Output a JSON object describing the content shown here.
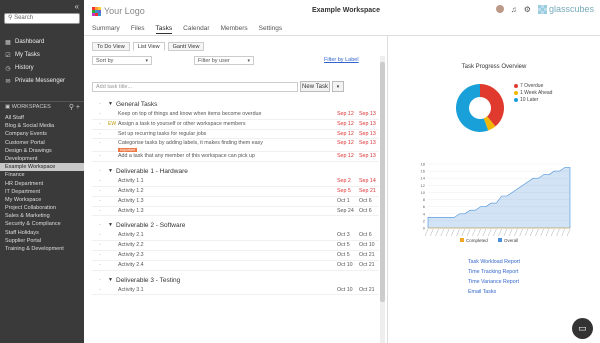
{
  "sidebar": {
    "search_placeholder": "Search",
    "nav": [
      {
        "label": "Dashboard",
        "icon": "dashboard-icon"
      },
      {
        "label": "My Tasks",
        "icon": "check-icon"
      },
      {
        "label": "History",
        "icon": "clock-icon"
      },
      {
        "label": "Private Messenger",
        "icon": "chat-icon"
      }
    ],
    "workspaces_label": "WORKSPACES",
    "workspaces": [
      "All Staff",
      "Blog & Social Media",
      "Company Events",
      "Customer Portal",
      "Design & Drawings",
      "Development",
      "Example Workspace",
      "Finance",
      "HR Department",
      "IT Department",
      "My Workspace",
      "Project Collaboration",
      "Sales & Marketing",
      "Security & Compliance",
      "Staff Holidays",
      "Supplier Portal",
      "Training & Development"
    ],
    "active_workspace": "Example Workspace"
  },
  "header": {
    "logo_text": "Your Logo",
    "workspace_title": "Example Workspace",
    "brand": "glasscubes",
    "tabs": [
      "Summary",
      "Files",
      "Tasks",
      "Calendar",
      "Members",
      "Settings"
    ],
    "active_tab": "Tasks"
  },
  "tasks_view": {
    "views": [
      "To Do View",
      "List View",
      "Gantt View"
    ],
    "sort_label": "Sort by",
    "filter_user_label": "Filter by user",
    "filter_label_link": "Filter by Label",
    "new_task_placeholder": "Add task title...",
    "new_task_button": "New Task",
    "groups": [
      {
        "name": "General Tasks",
        "tasks": [
          {
            "title": "Keep on top of things and know when items become overdue",
            "d1": "Sep 12",
            "d2": "Sep 13",
            "flag": ""
          },
          {
            "title": "Assign a task to yourself or other workspace members",
            "d1": "Sep 12",
            "d2": "Sep 13",
            "flag": "EW"
          },
          {
            "title": "Set up recurring tasks for regular jobs",
            "d1": "Sep 12",
            "d2": "Sep 13",
            "flag": ""
          },
          {
            "title": "Categorise tasks by adding labels, it makes finding them easy",
            "d1": "Sep 12",
            "d2": "Sep 13",
            "flag": "",
            "tag": "Important"
          },
          {
            "title": "Add a task that any member of this workspace can pick up",
            "d1": "Sep 12",
            "d2": "Sep 13",
            "flag": ""
          }
        ]
      },
      {
        "name": "Deliverable 1 - Hardware",
        "tasks": [
          {
            "title": "Activity 1.1",
            "d1": "Sep 2",
            "d2": "Sep 14",
            "flag": "",
            "ok": false
          },
          {
            "title": "Activity 1.2",
            "d1": "Sep 5",
            "d2": "Sep 21",
            "flag": "",
            "ok": false
          },
          {
            "title": "Activity 1.3",
            "d1": "Oct 1",
            "d2": "Oct 6",
            "flag": "",
            "ok": true
          },
          {
            "title": "Activity 1.3",
            "d1": "Sep 24",
            "d2": "Oct 6",
            "flag": "",
            "ok": true
          }
        ]
      },
      {
        "name": "Deliverable 2 - Software",
        "tasks": [
          {
            "title": "Activity 2.1",
            "d1": "Oct 3",
            "d2": "Oct 6",
            "flag": "",
            "ok": true
          },
          {
            "title": "Activity 2.2",
            "d1": "Oct 5",
            "d2": "Oct 10",
            "flag": "",
            "ok": true
          },
          {
            "title": "Activity 2.3",
            "d1": "Oct 5",
            "d2": "Oct 21",
            "flag": "",
            "ok": true
          },
          {
            "title": "Activity 2.4",
            "d1": "Oct 10",
            "d2": "Oct 21",
            "flag": "",
            "ok": true
          }
        ]
      },
      {
        "name": "Deliverable 3 - Testing",
        "tasks": [
          {
            "title": "Activity 3.1",
            "d1": "Oct 10",
            "d2": "Oct 21",
            "flag": "",
            "ok": true
          }
        ]
      }
    ]
  },
  "overview": {
    "title": "Task Progress Overview",
    "legend": [
      {
        "label": "7 Overdue",
        "color": "#e03a2f"
      },
      {
        "label": "1 Week Ahead",
        "color": "#f2b705"
      },
      {
        "label": "10 Later",
        "color": "#1aa0d8"
      }
    ],
    "line_legend": [
      "Completed",
      "Overall"
    ],
    "links": [
      "Task Workload Report",
      "Time Tracking Report",
      "Time Variance Report",
      "Email Tasks"
    ]
  },
  "chart_data": [
    {
      "type": "pie",
      "labels": [
        "7 Overdue",
        "1 Week Ahead",
        "10 Later"
      ],
      "values": [
        7,
        1,
        10
      ],
      "colors": [
        "#e03a2f",
        "#f2b705",
        "#1aa0d8"
      ]
    },
    {
      "type": "area",
      "ylim": [
        0,
        18
      ],
      "yticks": [
        0,
        2,
        4,
        6,
        8,
        10,
        12,
        14,
        16,
        18
      ],
      "series": [
        {
          "name": "Overall",
          "color": "#4a90d9",
          "values": [
            3,
            3,
            3,
            3,
            3,
            3,
            4,
            4,
            5,
            5,
            6,
            6,
            7,
            7,
            9,
            9,
            10,
            11,
            12,
            13,
            14,
            14,
            15,
            15,
            16,
            16,
            17,
            17
          ]
        },
        {
          "name": "Completed",
          "color": "#f5a623",
          "values": [
            0,
            0,
            0,
            0,
            0,
            0,
            0,
            0,
            0,
            0,
            0,
            0,
            0,
            0,
            0,
            0,
            0,
            0,
            0,
            0,
            0,
            0,
            0,
            0,
            0,
            0,
            0,
            0
          ]
        }
      ]
    }
  ],
  "colors": {
    "sidebar_bg": "#3a3a3a",
    "overdue": "#d33",
    "link": "#36c"
  }
}
